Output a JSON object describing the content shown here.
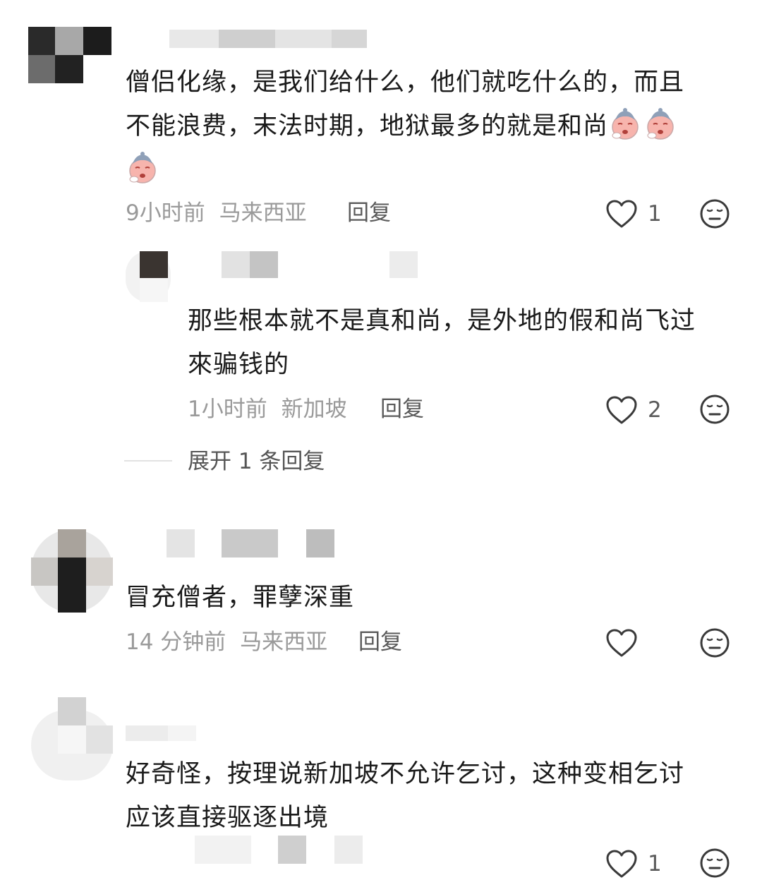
{
  "comments": [
    {
      "text_lines": [
        "僧侣化缘，是我们给什么，他们就吃什么的，而且",
        "不能浪费，末法时期，地狱最多的就是和尚"
      ],
      "emoji_count": 3,
      "time": "9小时前",
      "location": "马来西亚",
      "reply_label": "回复",
      "likes": "1"
    },
    {
      "text_lines": [
        "那些根本就不是真和尚，是外地的假和尚飞过",
        "來骗钱的"
      ],
      "time": "1小时前",
      "location": "新加坡",
      "reply_label": "回复",
      "likes": "2"
    },
    {
      "text_lines": [
        "冒充僧者，罪孽深重"
      ],
      "time": "14 分钟前",
      "location": "马来西亚",
      "reply_label": "回复",
      "likes": ""
    },
    {
      "text_lines": [
        "好奇怪，按理说新加坡不允许乞讨，这种变相乞讨",
        "应该直接驱逐出境"
      ],
      "likes": "1"
    }
  ],
  "expand_replies": "展开 1 条回复",
  "icons": {
    "like": "heart-outline-icon",
    "dislike": "neutral-face-icon",
    "emoji": "crying-face-emoji"
  },
  "colors": {
    "text": "#1a1a1a",
    "meta": "#9a9a9a",
    "icon": "#3a3a3a",
    "divider": "#e2e2e2"
  }
}
